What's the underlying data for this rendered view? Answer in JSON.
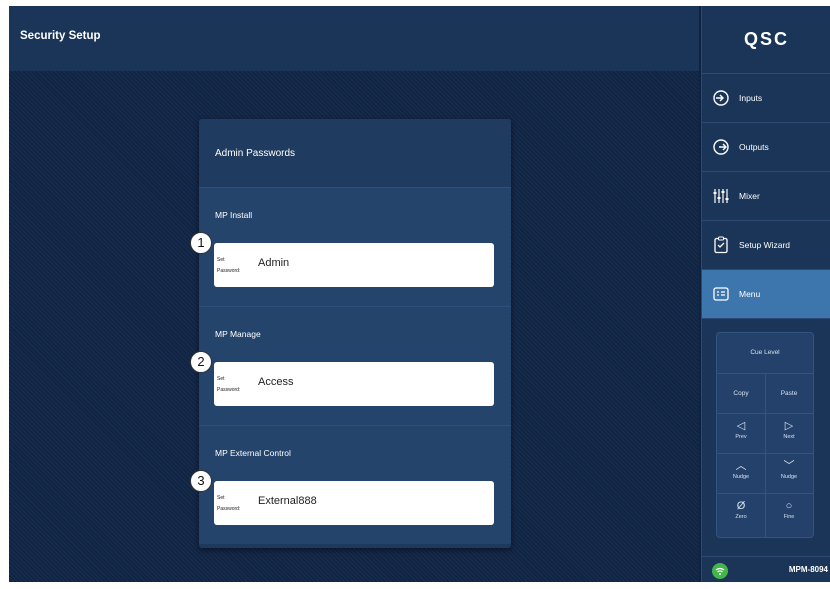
{
  "header": {
    "title": "Security Setup"
  },
  "card": {
    "heading": "Admin Passwords",
    "sections": [
      {
        "label": "MP Install",
        "prefix_line1": "Set",
        "prefix_line2": "Password:",
        "value": "Admin",
        "callout": "1"
      },
      {
        "label": "MP Manage",
        "prefix_line1": "Set",
        "prefix_line2": "Password:",
        "value": "Access",
        "callout": "2"
      },
      {
        "label": "MP External Control",
        "prefix_line1": "Set",
        "prefix_line2": "Password:",
        "value": "External888",
        "callout": "3"
      }
    ]
  },
  "sidebar": {
    "logo": "QSC",
    "items": [
      {
        "label": "Inputs",
        "icon": "inputs-icon"
      },
      {
        "label": "Outputs",
        "icon": "outputs-icon"
      },
      {
        "label": "Mixer",
        "icon": "mixer-icon"
      },
      {
        "label": "Setup Wizard",
        "icon": "setup-wizard-icon"
      },
      {
        "label": "Menu",
        "icon": "menu-icon",
        "active": true
      }
    ],
    "keypad": {
      "cue_level": "Cue Level",
      "copy": "Copy",
      "paste": "Paste",
      "prev_glyph": "◁",
      "prev": "Prev",
      "next_glyph": "▷",
      "next": "Next",
      "nudge_up_glyph": "︿",
      "nudge_up": "Nudge",
      "nudge_down_glyph": "﹀",
      "nudge_down": "Nudge",
      "zero_glyph": "Ø",
      "zero": "Zero",
      "fine_glyph": "○",
      "fine": "Fine"
    },
    "status": {
      "model": "MPM-8094",
      "wifi_color": "#45b549"
    }
  },
  "colors": {
    "background": "#102444",
    "panel": "#1a3558",
    "section": "#24446c",
    "active": "#3c76ad"
  }
}
